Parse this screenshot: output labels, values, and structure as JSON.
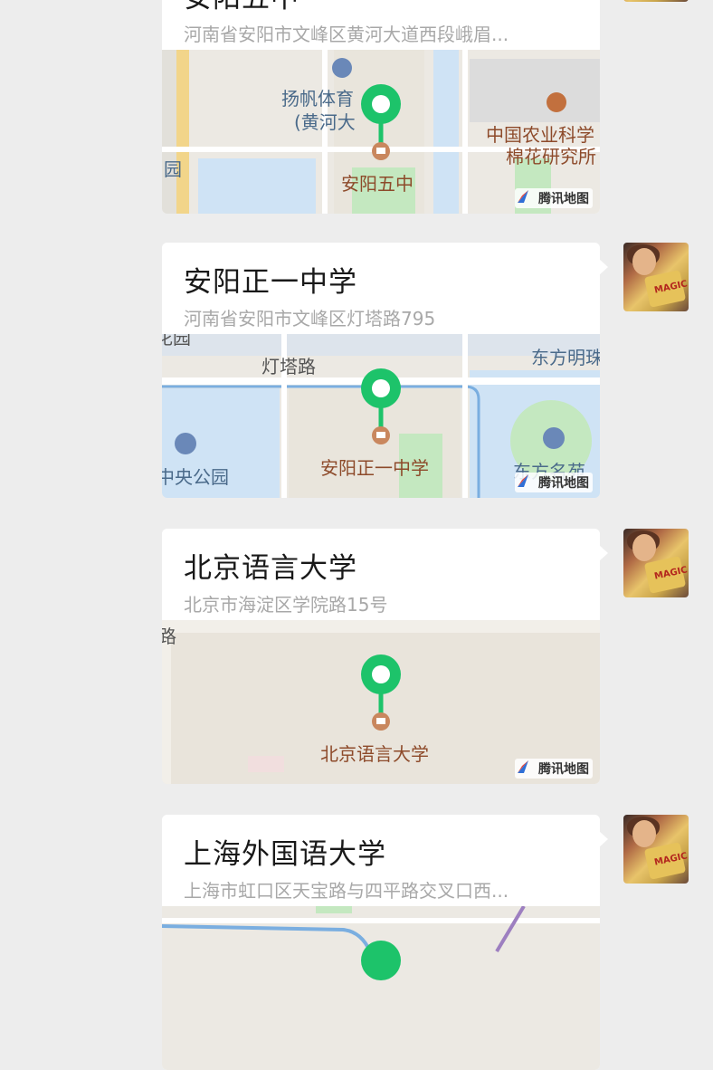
{
  "messages": [
    {
      "title": "安阳五中",
      "address": "河南省安阳市文峰区黄河大道西段峨眉...",
      "poi_label": "安阳五中",
      "labels": [
        "扬帆体育",
        "(黄河大",
        "中国农业科学",
        "棉花研究所",
        "园"
      ]
    },
    {
      "title": "安阳正一中学",
      "address": "河南省安阳市文峰区灯塔路795",
      "poi_label": "安阳正一中学",
      "labels": [
        "灯塔路",
        "东方明珠",
        "中央公园",
        "东方名苑",
        "花园"
      ]
    },
    {
      "title": "北京语言大学",
      "address": "北京市海淀区学院路15号",
      "poi_label": "北京语言大学",
      "labels": [
        "北京语言大学",
        "路"
      ]
    },
    {
      "title": "上海外国语大学",
      "address": "上海市虹口区天宝路与四平路交叉口西..."
    }
  ],
  "watermark": "腾讯地图",
  "colors": {
    "pin": "#1dc36a",
    "poi_text": "#8d4a2a",
    "park": "#c4e8c0",
    "water": "#cfe3f5",
    "block": "#e9e5dc"
  }
}
